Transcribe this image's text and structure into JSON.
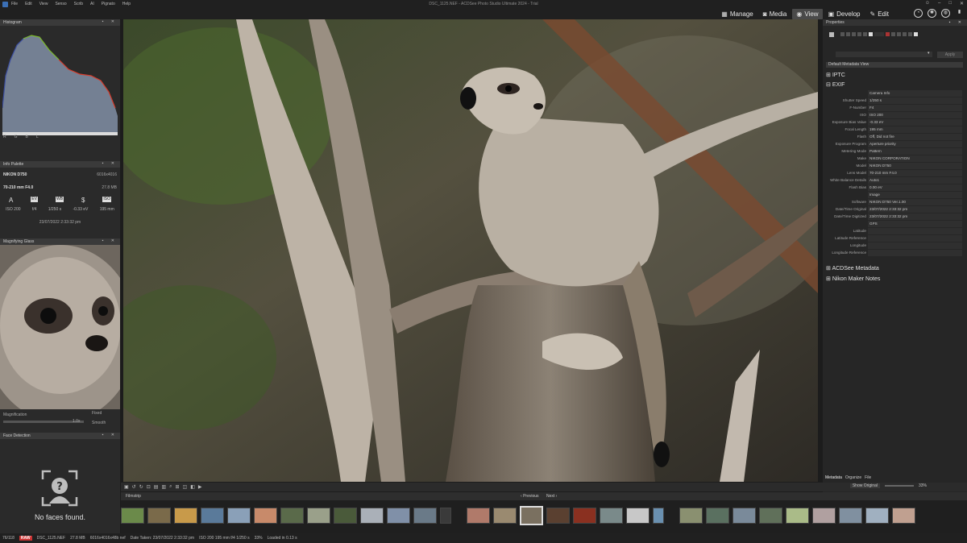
{
  "menu": {
    "items": [
      "File",
      "Edit",
      "View",
      "Senso",
      "Scrib",
      "AI",
      "Pignato",
      "Help"
    ]
  },
  "window_title": "DSC_1125.NEF - ACDSee Photo Studio Ultimate 2024 - Trial",
  "modes": [
    {
      "label": "Manage",
      "icon": "grid-icon",
      "active": false
    },
    {
      "label": "Media",
      "icon": "camera-icon",
      "active": false
    },
    {
      "label": "View",
      "icon": "eye-icon",
      "active": true
    },
    {
      "label": "Develop",
      "icon": "develop-icon",
      "active": false
    },
    {
      "label": "Edit",
      "icon": "edit-icon",
      "active": false
    }
  ],
  "histogram": {
    "title": "Histogram",
    "checks": [
      "R",
      "G",
      "B",
      "L"
    ]
  },
  "info_palette": {
    "title": "Info Palette",
    "camera": "NIKON D750",
    "resolution": "6016x4016",
    "lens": "70-210 mm F4.0",
    "filesize": "27.8 MB",
    "glyphs": [
      "A",
      "EV",
      "WB",
      "$",
      "ISO"
    ],
    "values": [
      "ISO 200",
      "f/4",
      "1/250 s",
      "-0.33 eV",
      "195 mm"
    ],
    "datetime": "23/07/2022 2:33:32 pm"
  },
  "magnifier": {
    "title": "Magnifying Glass",
    "label": "Magnification",
    "value": "1.0x",
    "opt1": "Fixed",
    "opt2": "Smooth"
  },
  "faces": {
    "title": "Face Detection",
    "message": "No faces found."
  },
  "properties": {
    "tab": "Properties",
    "apply": "Apply",
    "metadata_view": "Default Metadata View",
    "iptc": "IPTC",
    "exif": "EXIF",
    "acdsee": "ACDSee Metadata",
    "nikon": "Nikon Maker Notes",
    "fields": [
      {
        "k": "",
        "v": "Camera Info"
      },
      {
        "k": "Shutter Speed",
        "v": "1/250 s"
      },
      {
        "k": "F-Number",
        "v": "F4"
      },
      {
        "k": "ISO",
        "v": "ISO 200"
      },
      {
        "k": "Exposure Bias Value",
        "v": "-0.33 eV"
      },
      {
        "k": "Focal Length",
        "v": "195 mm"
      },
      {
        "k": "Flash",
        "v": "Off, Did not fire"
      },
      {
        "k": "Exposure Program",
        "v": "Aperture priority"
      },
      {
        "k": "Metering Mode",
        "v": "Pattern"
      },
      {
        "k": "Make",
        "v": "NIKON CORPORATION"
      },
      {
        "k": "Model",
        "v": "NIKON D750"
      },
      {
        "k": "Lens Model",
        "v": "70-210 mm F4.0"
      },
      {
        "k": "White Balance Details",
        "v": "Auto1"
      },
      {
        "k": "Flash Bias",
        "v": "0.00 eV"
      },
      {
        "k": "",
        "v": "Image"
      },
      {
        "k": "Software",
        "v": "NIKON D750 Ver.1.00"
      },
      {
        "k": "Date/Time Original",
        "v": "23/07/2022 2:33:32 pm"
      },
      {
        "k": "Date/Time Digitized",
        "v": "23/07/2022 2:33:32 pm"
      },
      {
        "k": "",
        "v": "GPS"
      },
      {
        "k": "Latitude",
        "v": ""
      },
      {
        "k": "Latitude Reference",
        "v": ""
      },
      {
        "k": "Longitude",
        "v": ""
      },
      {
        "k": "Longitude Reference",
        "v": ""
      }
    ],
    "bottom_tabs": [
      "Metadata",
      "Organize",
      "File"
    ]
  },
  "toolbar": {
    "zoom_mode": "Show Original",
    "zoom": "33%"
  },
  "filmstrip": {
    "title": "Filmstrip",
    "prev": "Previous",
    "next": "Next"
  },
  "status": {
    "count": "76/118",
    "format": "RAW",
    "filename": "DSC_1125.NEF",
    "size": "27.8 MB",
    "dims": "6016x4016x48b nef",
    "date": "Date Taken: 23/07/2022 2:33:32 pm",
    "specs": "ISO 200   195 mm   f/4   1/250 s",
    "zoom": "33%",
    "load": "Loaded in 0.13 s"
  }
}
